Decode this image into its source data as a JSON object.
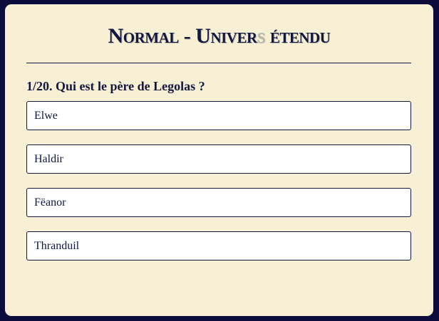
{
  "quiz": {
    "title_main": "Normal - Univer",
    "title_faded": "s",
    "title_end": " étendu",
    "question": "1/20. Qui est le père de Legolas ?",
    "answers": [
      {
        "label": "Elwe"
      },
      {
        "label": "Haldir"
      },
      {
        "label": "Fëanor"
      },
      {
        "label": "Thranduil"
      }
    ]
  },
  "colors": {
    "page_background": "#0b0c3b",
    "card_background": "#f8f0d5",
    "text": "#12173f",
    "answer_background": "#ffffff"
  }
}
